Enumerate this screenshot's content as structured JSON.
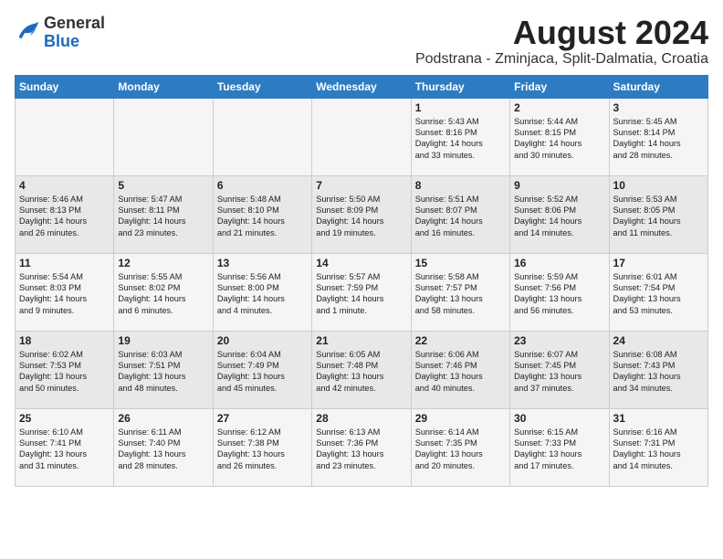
{
  "logo": {
    "general": "General",
    "blue": "Blue"
  },
  "header": {
    "month": "August 2024",
    "location": "Podstrana - Zminjaca, Split-Dalmatia, Croatia"
  },
  "days_of_week": [
    "Sunday",
    "Monday",
    "Tuesday",
    "Wednesday",
    "Thursday",
    "Friday",
    "Saturday"
  ],
  "weeks": [
    [
      {
        "day": "",
        "content": ""
      },
      {
        "day": "",
        "content": ""
      },
      {
        "day": "",
        "content": ""
      },
      {
        "day": "",
        "content": ""
      },
      {
        "day": "1",
        "content": "Sunrise: 5:43 AM\nSunset: 8:16 PM\nDaylight: 14 hours\nand 33 minutes."
      },
      {
        "day": "2",
        "content": "Sunrise: 5:44 AM\nSunset: 8:15 PM\nDaylight: 14 hours\nand 30 minutes."
      },
      {
        "day": "3",
        "content": "Sunrise: 5:45 AM\nSunset: 8:14 PM\nDaylight: 14 hours\nand 28 minutes."
      }
    ],
    [
      {
        "day": "4",
        "content": "Sunrise: 5:46 AM\nSunset: 8:13 PM\nDaylight: 14 hours\nand 26 minutes."
      },
      {
        "day": "5",
        "content": "Sunrise: 5:47 AM\nSunset: 8:11 PM\nDaylight: 14 hours\nand 23 minutes."
      },
      {
        "day": "6",
        "content": "Sunrise: 5:48 AM\nSunset: 8:10 PM\nDaylight: 14 hours\nand 21 minutes."
      },
      {
        "day": "7",
        "content": "Sunrise: 5:50 AM\nSunset: 8:09 PM\nDaylight: 14 hours\nand 19 minutes."
      },
      {
        "day": "8",
        "content": "Sunrise: 5:51 AM\nSunset: 8:07 PM\nDaylight: 14 hours\nand 16 minutes."
      },
      {
        "day": "9",
        "content": "Sunrise: 5:52 AM\nSunset: 8:06 PM\nDaylight: 14 hours\nand 14 minutes."
      },
      {
        "day": "10",
        "content": "Sunrise: 5:53 AM\nSunset: 8:05 PM\nDaylight: 14 hours\nand 11 minutes."
      }
    ],
    [
      {
        "day": "11",
        "content": "Sunrise: 5:54 AM\nSunset: 8:03 PM\nDaylight: 14 hours\nand 9 minutes."
      },
      {
        "day": "12",
        "content": "Sunrise: 5:55 AM\nSunset: 8:02 PM\nDaylight: 14 hours\nand 6 minutes."
      },
      {
        "day": "13",
        "content": "Sunrise: 5:56 AM\nSunset: 8:00 PM\nDaylight: 14 hours\nand 4 minutes."
      },
      {
        "day": "14",
        "content": "Sunrise: 5:57 AM\nSunset: 7:59 PM\nDaylight: 14 hours\nand 1 minute."
      },
      {
        "day": "15",
        "content": "Sunrise: 5:58 AM\nSunset: 7:57 PM\nDaylight: 13 hours\nand 58 minutes."
      },
      {
        "day": "16",
        "content": "Sunrise: 5:59 AM\nSunset: 7:56 PM\nDaylight: 13 hours\nand 56 minutes."
      },
      {
        "day": "17",
        "content": "Sunrise: 6:01 AM\nSunset: 7:54 PM\nDaylight: 13 hours\nand 53 minutes."
      }
    ],
    [
      {
        "day": "18",
        "content": "Sunrise: 6:02 AM\nSunset: 7:53 PM\nDaylight: 13 hours\nand 50 minutes."
      },
      {
        "day": "19",
        "content": "Sunrise: 6:03 AM\nSunset: 7:51 PM\nDaylight: 13 hours\nand 48 minutes."
      },
      {
        "day": "20",
        "content": "Sunrise: 6:04 AM\nSunset: 7:49 PM\nDaylight: 13 hours\nand 45 minutes."
      },
      {
        "day": "21",
        "content": "Sunrise: 6:05 AM\nSunset: 7:48 PM\nDaylight: 13 hours\nand 42 minutes."
      },
      {
        "day": "22",
        "content": "Sunrise: 6:06 AM\nSunset: 7:46 PM\nDaylight: 13 hours\nand 40 minutes."
      },
      {
        "day": "23",
        "content": "Sunrise: 6:07 AM\nSunset: 7:45 PM\nDaylight: 13 hours\nand 37 minutes."
      },
      {
        "day": "24",
        "content": "Sunrise: 6:08 AM\nSunset: 7:43 PM\nDaylight: 13 hours\nand 34 minutes."
      }
    ],
    [
      {
        "day": "25",
        "content": "Sunrise: 6:10 AM\nSunset: 7:41 PM\nDaylight: 13 hours\nand 31 minutes."
      },
      {
        "day": "26",
        "content": "Sunrise: 6:11 AM\nSunset: 7:40 PM\nDaylight: 13 hours\nand 28 minutes."
      },
      {
        "day": "27",
        "content": "Sunrise: 6:12 AM\nSunset: 7:38 PM\nDaylight: 13 hours\nand 26 minutes."
      },
      {
        "day": "28",
        "content": "Sunrise: 6:13 AM\nSunset: 7:36 PM\nDaylight: 13 hours\nand 23 minutes."
      },
      {
        "day": "29",
        "content": "Sunrise: 6:14 AM\nSunset: 7:35 PM\nDaylight: 13 hours\nand 20 minutes."
      },
      {
        "day": "30",
        "content": "Sunrise: 6:15 AM\nSunset: 7:33 PM\nDaylight: 13 hours\nand 17 minutes."
      },
      {
        "day": "31",
        "content": "Sunrise: 6:16 AM\nSunset: 7:31 PM\nDaylight: 13 hours\nand 14 minutes."
      }
    ]
  ]
}
